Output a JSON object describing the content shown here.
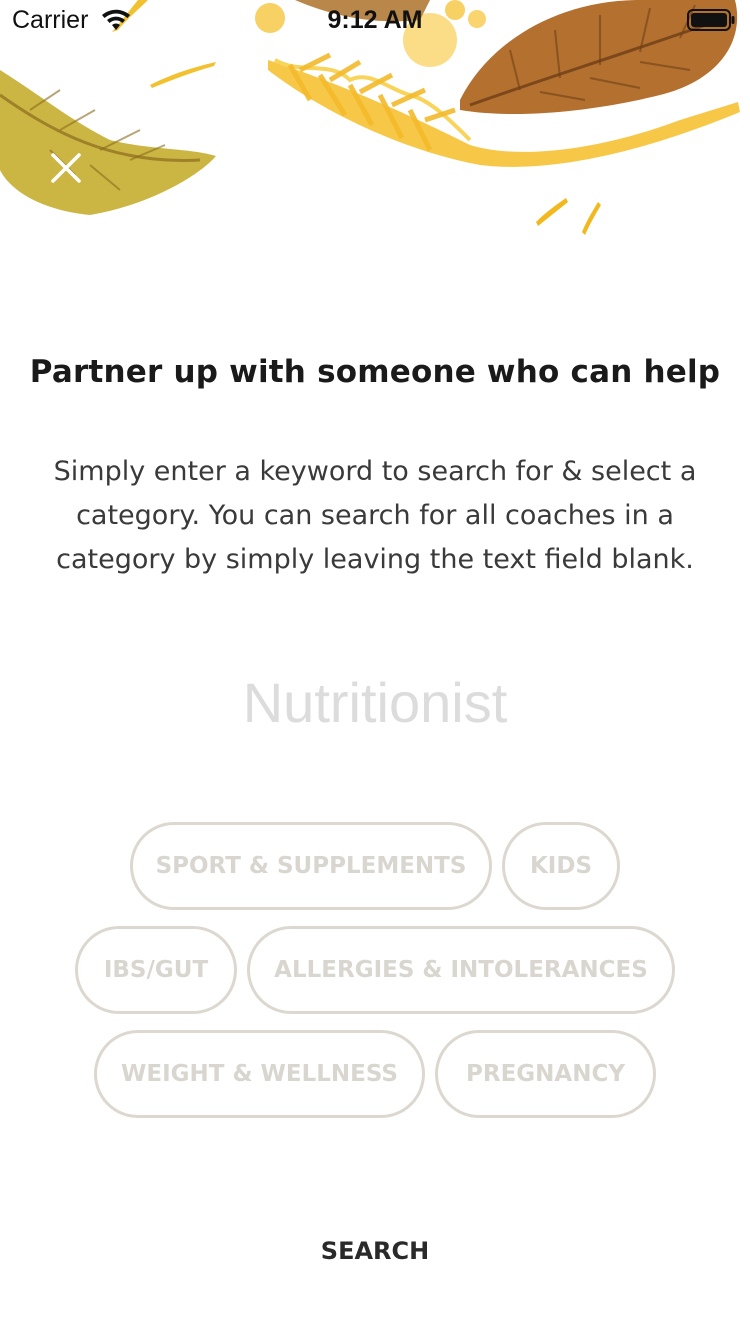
{
  "status_bar": {
    "carrier": "Carrier",
    "time": "9:12 AM",
    "wifi_icon": "wifi-icon",
    "battery_icon": "battery-icon"
  },
  "header": {
    "close_icon": "close-icon",
    "illustration": "autumn-leaves-watercolor"
  },
  "content": {
    "title": "Partner up with someone who can help",
    "description": "Simply enter a keyword to search for & select a category. You can search for all coaches in a category by simply leaving the text field blank."
  },
  "search": {
    "placeholder": "Nutritionist",
    "value": ""
  },
  "categories": [
    "SPORT & SUPPLEMENTS",
    "KIDS",
    "IBS/GUT",
    "ALLERGIES & INTOLERANCES",
    "WEIGHT & WELLNESS",
    "PREGNANCY"
  ],
  "actions": {
    "search_label": "SEARCH"
  },
  "colors": {
    "chip_border": "#dcd8d0",
    "chip_text": "#d9d6d0",
    "leaf_brown": "#a8652b",
    "leaf_olive": "#c9b234",
    "leaf_yellow": "#f6c23b",
    "placeholder": "#dcdcdc"
  }
}
